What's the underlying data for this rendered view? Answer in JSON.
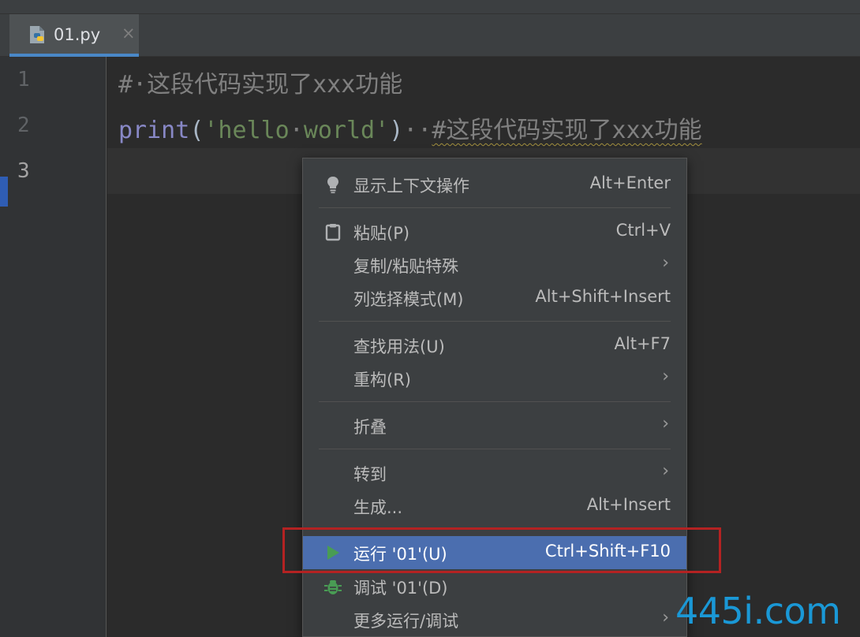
{
  "tab": {
    "filename": "01.py",
    "close_glyph": "×"
  },
  "gutter": {
    "line_numbers": [
      "1",
      "2",
      "3"
    ]
  },
  "code": {
    "line1": {
      "hash": "#",
      "dot": "·",
      "text": "这段代码实现了xxx功能"
    },
    "line2": {
      "func": "print",
      "open_paren": "(",
      "string_open": "'hello",
      "dot": "·",
      "string_close": "world'",
      "close_paren": ")",
      "spacer": "··",
      "comment": "#这段代码实现了xxx功能"
    }
  },
  "context_menu": {
    "items": [
      {
        "label": "显示上下文操作",
        "shortcut": "Alt+Enter"
      },
      {
        "label": "粘贴(P)",
        "shortcut": "Ctrl+V"
      },
      {
        "label": "复制/粘贴特殊",
        "submenu": "›"
      },
      {
        "label": "列选择模式(M)",
        "shortcut": "Alt+Shift+Insert"
      },
      {
        "label": "查找用法(U)",
        "shortcut": "Alt+F7"
      },
      {
        "label": "重构(R)",
        "submenu": "›"
      },
      {
        "label": "折叠",
        "submenu": "›"
      },
      {
        "label": "转到",
        "submenu": "›"
      },
      {
        "label": "生成...",
        "shortcut": "Alt+Insert"
      },
      {
        "label": "运行 '01'(U)",
        "shortcut": "Ctrl+Shift+F10",
        "selected": true
      },
      {
        "label": "调试 '01'(D)"
      },
      {
        "label": "更多运行/调试",
        "submenu": "›"
      }
    ]
  },
  "watermark": "445i.com",
  "colors": {
    "selection": "#4b6eaf",
    "highlight_box": "#b42222",
    "run_icon": "#499c54",
    "debug_icon": "#499c54",
    "watermark": "#1a98d6"
  },
  "icons": {
    "tab": "python-file-icon",
    "context_actions": "lightbulb-icon",
    "paste": "clipboard-icon",
    "run": "play-icon",
    "debug": "bug-icon"
  }
}
